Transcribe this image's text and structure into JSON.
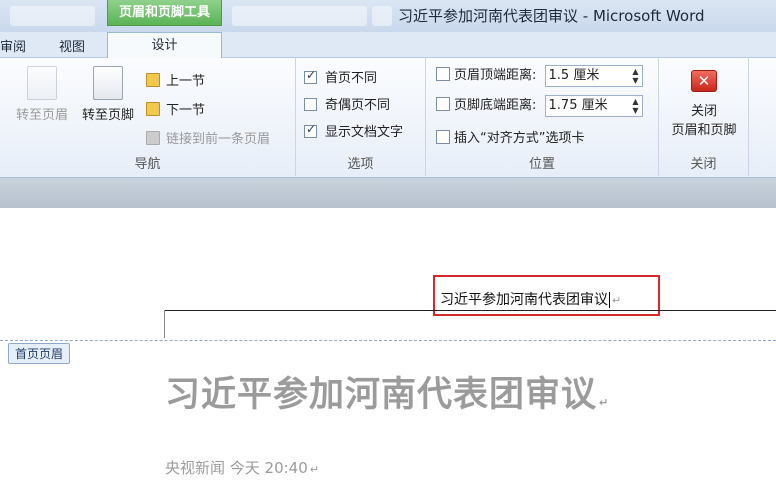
{
  "window": {
    "title": "习近平参加河南代表团审议 - Microsoft Word",
    "context_tab_group": "页眉和页脚工具"
  },
  "tabs": {
    "review": "审阅",
    "view": "视图",
    "design": "设计"
  },
  "ribbon": {
    "nav": {
      "goto_header": "转至页眉",
      "goto_footer": "转至页脚",
      "prev_section": "上一节",
      "next_section": "下一节",
      "link_previous": "链接到前一条页眉",
      "label": "导航"
    },
    "options": {
      "different_first": "首页不同",
      "different_odd_even": "奇偶页不同",
      "show_doc_text": "显示文档文字",
      "different_first_checked": true,
      "different_odd_even_checked": false,
      "show_doc_text_checked": true,
      "label": "选项"
    },
    "position": {
      "header_top_label": "页眉顶端距离:",
      "header_top_value": "1.5 厘米",
      "footer_bottom_label": "页脚底端距离:",
      "footer_bottom_value": "1.75 厘米",
      "insert_align_tab": "插入“对齐方式”选项卡",
      "label": "位置"
    },
    "close": {
      "button_line1": "关闭",
      "button_line2": "页眉和页脚",
      "label": "关闭"
    }
  },
  "document": {
    "header_text": "习近平参加河南代表团审议",
    "header_region_label": "首页页眉",
    "title": "习近平参加河南代表团审议",
    "meta": "央视新闻 今天 20:40"
  }
}
